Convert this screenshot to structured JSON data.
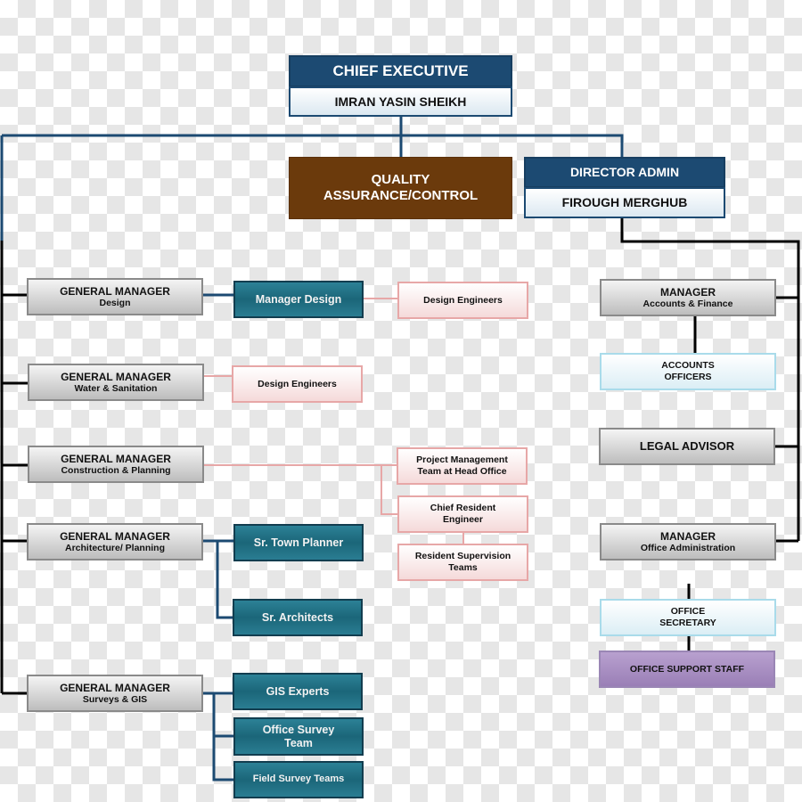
{
  "chief_executive": {
    "title": "CHIEF EXECUTIVE",
    "name": "IMRAN YASIN SHEIKH"
  },
  "quality": {
    "line1": "QUALITY",
    "line2": "ASSURANCE/CONTROL"
  },
  "director_admin": {
    "title": "DIRECTOR ADMIN",
    "name": "FIROUGH MERGHUB"
  },
  "general_managers": [
    {
      "title": "GENERAL MANAGER",
      "dept": "Design"
    },
    {
      "title": "GENERAL MANAGER",
      "dept": "Water & Sanitation"
    },
    {
      "title": "GENERAL MANAGER",
      "dept": "Construction & Planning"
    },
    {
      "title": "GENERAL MANAGER",
      "dept": "Architecture/ Planning"
    },
    {
      "title": "GENERAL MANAGER",
      "dept": "Surveys & GIS"
    }
  ],
  "teams": {
    "manager_design": "Manager Design",
    "design_engineers_1": "Design Engineers",
    "design_engineers_2": "Design Engineers",
    "pm_team": [
      "Project Management",
      "Team at Head Office"
    ],
    "chief_resident": [
      "Chief Resident",
      "Engineer"
    ],
    "resident_supervision": [
      "Resident Supervision",
      "Teams"
    ],
    "sr_town_planner": "Sr. Town Planner",
    "sr_architects": "Sr. Architects",
    "gis_experts": "GIS Experts",
    "office_survey": [
      "Office Survey",
      "Team"
    ],
    "field_survey": "Field Survey Teams"
  },
  "admin": {
    "manager_af": {
      "title": "MANAGER",
      "dept": "Accounts & Finance"
    },
    "accounts_officers": [
      "ACCOUNTS",
      "OFFICERS"
    ],
    "legal_advisor": "LEGAL ADVISOR",
    "manager_oa": {
      "title": "MANAGER",
      "dept": "Office Administration"
    },
    "office_secretary": [
      "OFFICE",
      "SECRETARY"
    ],
    "office_support_staff": "OFFICE SUPPORT STAFF"
  },
  "colors": {
    "navy": "#1c4a72",
    "brown": "#6b3a0c",
    "teal": "#1b6679",
    "pink_border": "#e7a7a7",
    "light_blue_border": "#a9dbea",
    "purple": "#9a7fb6"
  }
}
